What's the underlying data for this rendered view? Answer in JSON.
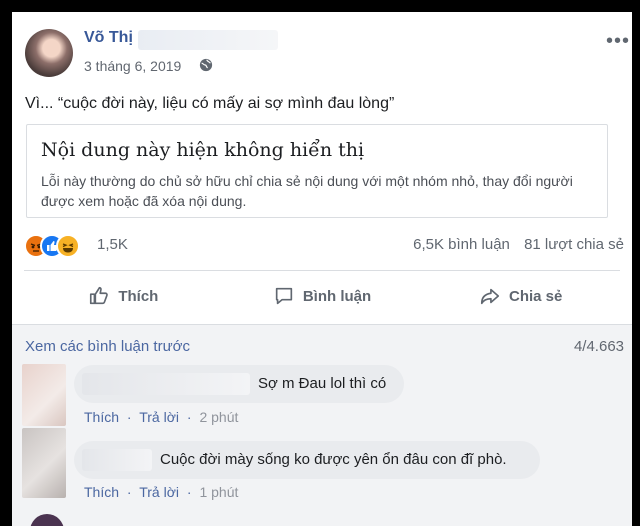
{
  "post": {
    "author": "Võ Thị",
    "date": "3 tháng 6, 2019",
    "text": "Vì... “cuộc đời này, liệu có mấy ai sợ mình đau lòng”",
    "unavailable_title": "Nội dung này hiện không hiển thị",
    "unavailable_desc": "Lỗi này thường do chủ sở hữu chỉ chia sẻ nội dung với một nhóm nhỏ, thay đổi người được xem hoặc đã xóa nội dung.",
    "reaction_count": "1,5K",
    "comment_count": "6,5K bình luận",
    "share_count": "81 lượt chia sẻ"
  },
  "actions": {
    "like": "Thích",
    "comment": "Bình luận",
    "share": "Chia sẻ"
  },
  "comments_section": {
    "prev_label": "Xem các bình luận trước",
    "pager": "4/4.663"
  },
  "comments": [
    {
      "text": "Sợ m Đau lol thì có",
      "like": "Thích",
      "reply": "Trả lời",
      "time": "2 phút"
    },
    {
      "text": "Cuộc đời mày sống ko được yên ổn đâu con đĩ phò.",
      "like": "Thích",
      "reply": "Trả lời",
      "time": "1 phút"
    }
  ],
  "colors": {
    "link": "#385898",
    "comment_link": "#4b67a1",
    "like": "#1877f2",
    "angry": "#e9710f",
    "haha": "#f7b125"
  },
  "icons": [
    "globe-icon",
    "more-icon",
    "angry-reaction-icon",
    "like-reaction-icon",
    "haha-reaction-icon",
    "thumbs-up-icon",
    "comment-bubble-icon",
    "share-arrow-icon"
  ]
}
